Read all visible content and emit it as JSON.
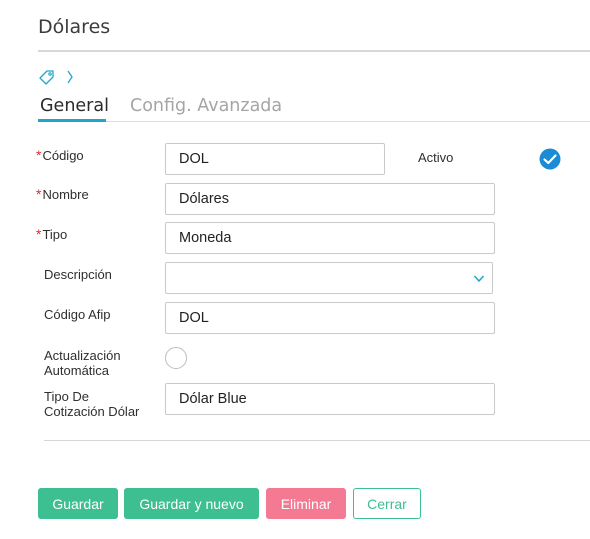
{
  "page": {
    "title": "Dólares"
  },
  "tabs": [
    {
      "label": "General",
      "active": true
    },
    {
      "label": "Config. Avanzada",
      "active": false
    }
  ],
  "form": {
    "codigo": {
      "label": "Código",
      "required": true,
      "value": "DOL"
    },
    "activo": {
      "label": "Activo",
      "checked": true
    },
    "nombre": {
      "label": "Nombre",
      "required": true,
      "value": "Dólares"
    },
    "tipo": {
      "label": "Tipo",
      "required": true,
      "value": "Moneda"
    },
    "descripcion": {
      "label": "Descripción",
      "value": ""
    },
    "codigo_afip": {
      "label": "Código Afip",
      "value": "DOL"
    },
    "actualizacion": {
      "label_line1": "Actualización",
      "label_line2": "Automática",
      "checked": false
    },
    "tipo_cotizacion": {
      "label_line1": "Tipo De",
      "label_line2": "Cotización Dólar",
      "value": "Dólar Blue"
    }
  },
  "buttons": {
    "save": "Guardar",
    "save_new": "Guardar y nuevo",
    "delete": "Eliminar",
    "close": "Cerrar"
  },
  "icons": {
    "breadcrumb": [
      "tag-icon",
      "chevron-right-icon"
    ],
    "activo": "check-circle-icon",
    "select": "chevron-down-icon"
  },
  "colors": {
    "accent": "#1fa6c9",
    "primary_button": "#3dbf92",
    "danger_button": "#f47a93",
    "required": "#e02a2a",
    "check": "#1a8bd4"
  }
}
